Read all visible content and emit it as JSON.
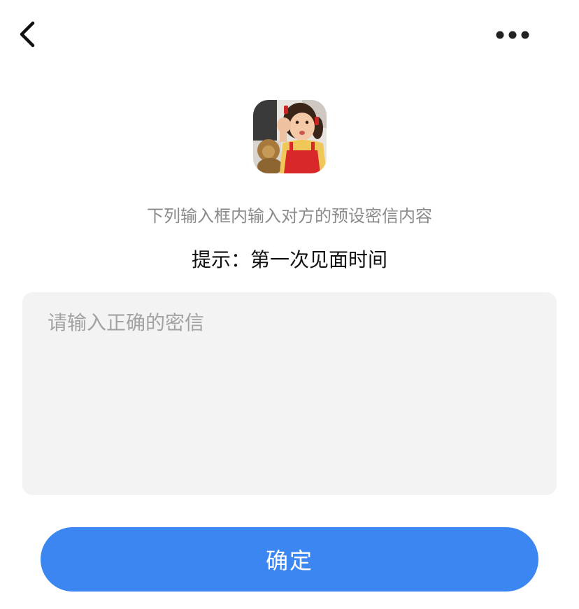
{
  "header": {
    "back_icon": "chevron-left-icon",
    "more_icon": "more-horizontal-icon"
  },
  "avatar": {
    "icon": "user-avatar-photo"
  },
  "instruction_text": "下列输入框内输入对方的预设密信内容",
  "hint_text": "提示：第一次见面时间",
  "password_input": {
    "value": "",
    "placeholder": "请输入正确的密信"
  },
  "confirm_button": {
    "label": "确定"
  },
  "colors": {
    "accent": "#3b86f0",
    "input_bg": "#f3f3f3",
    "muted_text": "#8a8a8a"
  }
}
